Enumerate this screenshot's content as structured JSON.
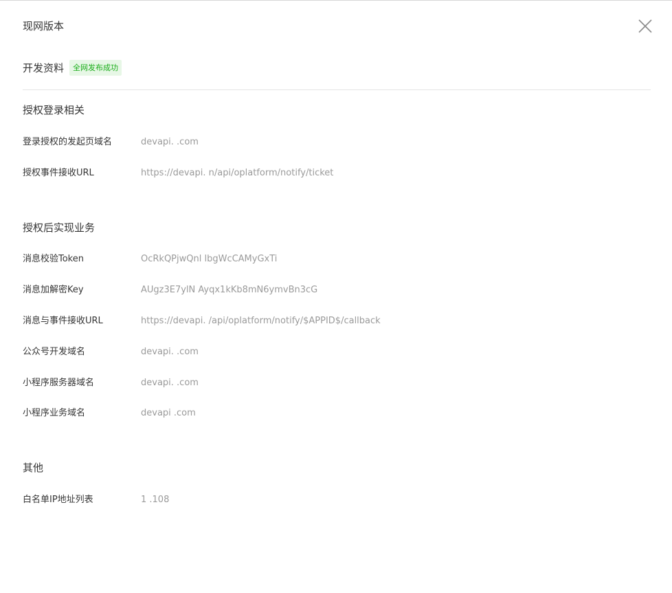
{
  "dialog": {
    "title": "现网版本",
    "close_icon": "close-icon"
  },
  "dev_info": {
    "heading": "开发资料",
    "badge": "全网发布成功"
  },
  "groups": [
    {
      "title": "授权登录相关",
      "rows": [
        {
          "label": "登录授权的发起页域名",
          "value": "devapi.          .com"
        },
        {
          "label": "授权事件接收URL",
          "value": "https://devapi.            n/api/oplatform/notify/ticket"
        }
      ]
    },
    {
      "title": "授权后实现业务",
      "rows": [
        {
          "label": "消息校验Token",
          "value": "OcRkQPjwQnl            lbgWcCAMyGxTi"
        },
        {
          "label": "消息加解密Key",
          "value": "AUgz3E7ylN                    Ayqx1kKb8mN6ymvBn3cG"
        },
        {
          "label": "消息与事件接收URL",
          "value": "https://devapi.              /api/oplatform/notify/$APPID$/callback"
        },
        {
          "label": "公众号开发域名",
          "value": "devapi.          .com"
        },
        {
          "label": "小程序服务器域名",
          "value": "devapi.          .com"
        },
        {
          "label": "小程序业务域名",
          "value": "devapi          .com"
        }
      ]
    },
    {
      "title": "其他",
      "rows": [
        {
          "label": "白名单IP地址列表",
          "value": "1          .108"
        }
      ]
    }
  ]
}
